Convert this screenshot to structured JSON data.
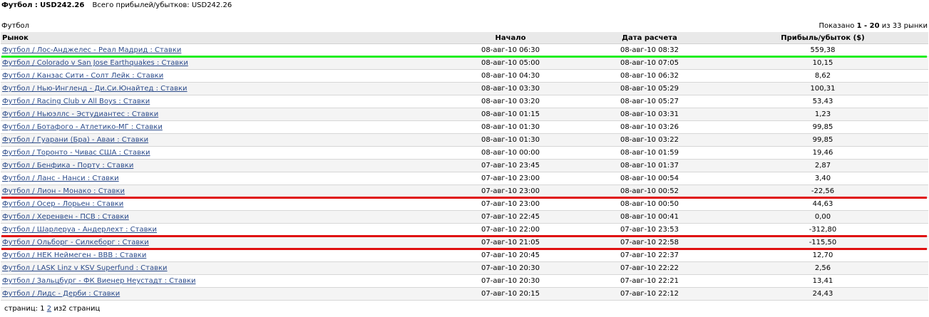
{
  "header": {
    "sport_label": "Футбол :",
    "sport_total": "USD242.26",
    "all_label": "Всего прибылей/убытков:",
    "all_total": "USD242.26"
  },
  "section": {
    "title": "Футбол",
    "showing_prefix": "Показано",
    "showing_range": "1 - 20",
    "showing_suffix": "из 33 рынки"
  },
  "table": {
    "columns": [
      "Рынок",
      "Начало",
      "Дата расчета",
      "Прибыль/убыток ($)"
    ],
    "rows": [
      {
        "market": "Футбол / Лос-Анджелес - Реал Мадрид : Ставки",
        "start": "08-авг-10 06:30",
        "settled": "08-авг-10 08:32",
        "pl": "559,38",
        "highlight": "green"
      },
      {
        "market": "Футбол / Colorado v San Jose Earthquakes : Ставки",
        "start": "08-авг-10 05:00",
        "settled": "08-авг-10 07:05",
        "pl": "10,15"
      },
      {
        "market": "Футбол / Канзас Сити - Солт Лейк : Ставки",
        "start": "08-авг-10 04:30",
        "settled": "08-авг-10 06:32",
        "pl": "8,62"
      },
      {
        "market": "Футбол / Нью-Ингленд - Ди.Си.Юнайтед : Ставки",
        "start": "08-авг-10 03:30",
        "settled": "08-авг-10 05:29",
        "pl": "100,31"
      },
      {
        "market": "Футбол / Racing Club v All Boys : Ставки",
        "start": "08-авг-10 03:20",
        "settled": "08-авг-10 05:27",
        "pl": "53,43"
      },
      {
        "market": "Футбол / Ньюэллс - Эстудиантес : Ставки",
        "start": "08-авг-10 01:15",
        "settled": "08-авг-10 03:31",
        "pl": "1,23"
      },
      {
        "market": "Футбол / Ботафого - Атлетико-МГ : Ставки",
        "start": "08-авг-10 01:30",
        "settled": "08-авг-10 03:26",
        "pl": "99,85"
      },
      {
        "market": "Футбол / Гуарани (Бра) - Аваи : Ставки",
        "start": "08-авг-10 01:30",
        "settled": "08-авг-10 03:22",
        "pl": "99,85"
      },
      {
        "market": "Футбол / Торонто - Чивас США : Ставки",
        "start": "08-авг-10 00:00",
        "settled": "08-авг-10 01:59",
        "pl": "19,46"
      },
      {
        "market": "Футбол / Бенфика - Порту : Ставки",
        "start": "07-авг-10 23:45",
        "settled": "08-авг-10 01:37",
        "pl": "2,87"
      },
      {
        "market": "Футбол / Ланс - Нанси : Ставки",
        "start": "07-авг-10 23:00",
        "settled": "08-авг-10 00:54",
        "pl": "3,40"
      },
      {
        "market": "Футбол / Лион - Монако : Ставки",
        "start": "07-авг-10 23:00",
        "settled": "08-авг-10 00:52",
        "pl": "-22,56",
        "highlight": "red"
      },
      {
        "market": "Футбол / Осер - Лорьен : Ставки",
        "start": "07-авг-10 23:00",
        "settled": "08-авг-10 00:50",
        "pl": "44,63"
      },
      {
        "market": "Футбол / Херенвен - ПСВ : Ставки",
        "start": "07-авг-10 22:45",
        "settled": "08-авг-10 00:41",
        "pl": "0,00"
      },
      {
        "market": "Футбол / Шарлеруа - Андерлехт : Ставки",
        "start": "07-авг-10 22:00",
        "settled": "07-авг-10 23:53",
        "pl": "-312,80",
        "highlight": "red"
      },
      {
        "market": "Футбол / Ольборг - Силкеборг : Ставки",
        "start": "07-авг-10 21:05",
        "settled": "07-авг-10 22:58",
        "pl": "-115,50",
        "highlight": "red"
      },
      {
        "market": "Футбол / НЕК Неймеген - ВВВ : Ставки",
        "start": "07-авг-10 20:45",
        "settled": "07-авг-10 22:37",
        "pl": "12,70"
      },
      {
        "market": "Футбол / LASK Linz v KSV Superfund : Ставки",
        "start": "07-авг-10 20:30",
        "settled": "07-авг-10 22:22",
        "pl": "2,56"
      },
      {
        "market": "Футбол / Зальцбург - ФК Виенер Неустадт : Ставки",
        "start": "07-авг-10 20:30",
        "settled": "07-авг-10 22:21",
        "pl": "13,41"
      },
      {
        "market": "Футбол / Лидс - Дерби : Ставки",
        "start": "07-авг-10 20:15",
        "settled": "07-авг-10 22:12",
        "pl": "24,43"
      }
    ]
  },
  "pager": {
    "label": "страниц:",
    "pages": [
      "1",
      "2"
    ],
    "current": "1",
    "summary": "из2 страниц"
  },
  "colors": {
    "green_mark": "#22ee22",
    "red_mark": "#e01010",
    "link": "#2a4a8a"
  }
}
